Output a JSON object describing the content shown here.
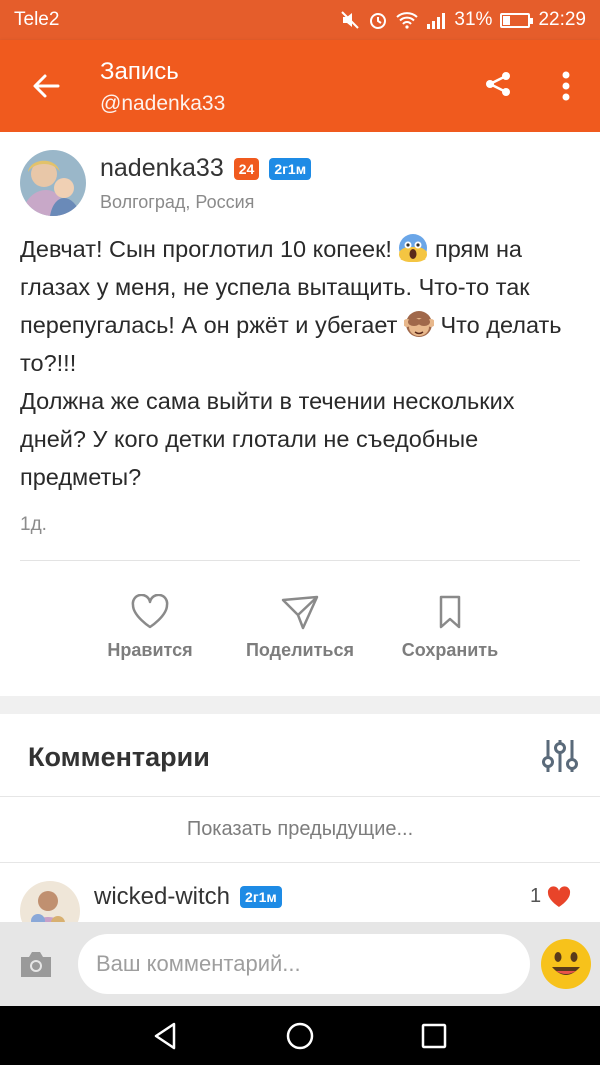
{
  "status_bar": {
    "carrier": "Tele2",
    "battery_percent": "31%",
    "battery_level": 0.31,
    "time": "22:29"
  },
  "app_bar": {
    "title": "Запись",
    "subtitle": "@nadenka33"
  },
  "post": {
    "author": {
      "name": "nadenka33",
      "age_badge": "24",
      "duration_badge": "2г1м",
      "location": "Волгоград, Россия"
    },
    "text": {
      "line1_a": "Девчат!  Сын проглотил 10 копеек! ",
      "line1_b": " прям на глазах у меня, не успела вытащить. Что-то так перепугалась! А он ржёт и убегает ",
      "line1_c": " Что делать то?!!!",
      "line2": "Должна же сама выйти в течении нескольких дней?  У кого детки глотали не съедобные предметы?"
    },
    "time": "1д.",
    "actions": {
      "like": "Нравится",
      "share": "Поделиться",
      "save": "Сохранить"
    }
  },
  "comments": {
    "header": "Комментарии",
    "show_previous": "Показать предыдущие...",
    "items": [
      {
        "author": "wicked-witch",
        "badge": "2г1м",
        "likes": "1"
      }
    ]
  },
  "input": {
    "placeholder": "Ваш комментарий..."
  },
  "colors": {
    "accent": "#f05a1e",
    "badge_blue": "#1e8be5",
    "like_heart": "#e8442a"
  },
  "icons": {
    "back": "arrow-left-icon",
    "share": "share-icon",
    "more": "more-vertical-icon",
    "like": "heart-outline-icon",
    "share_action": "paper-plane-icon",
    "save": "bookmark-icon",
    "filter": "sliders-icon",
    "camera": "camera-icon",
    "emoji": "smiley-icon"
  }
}
